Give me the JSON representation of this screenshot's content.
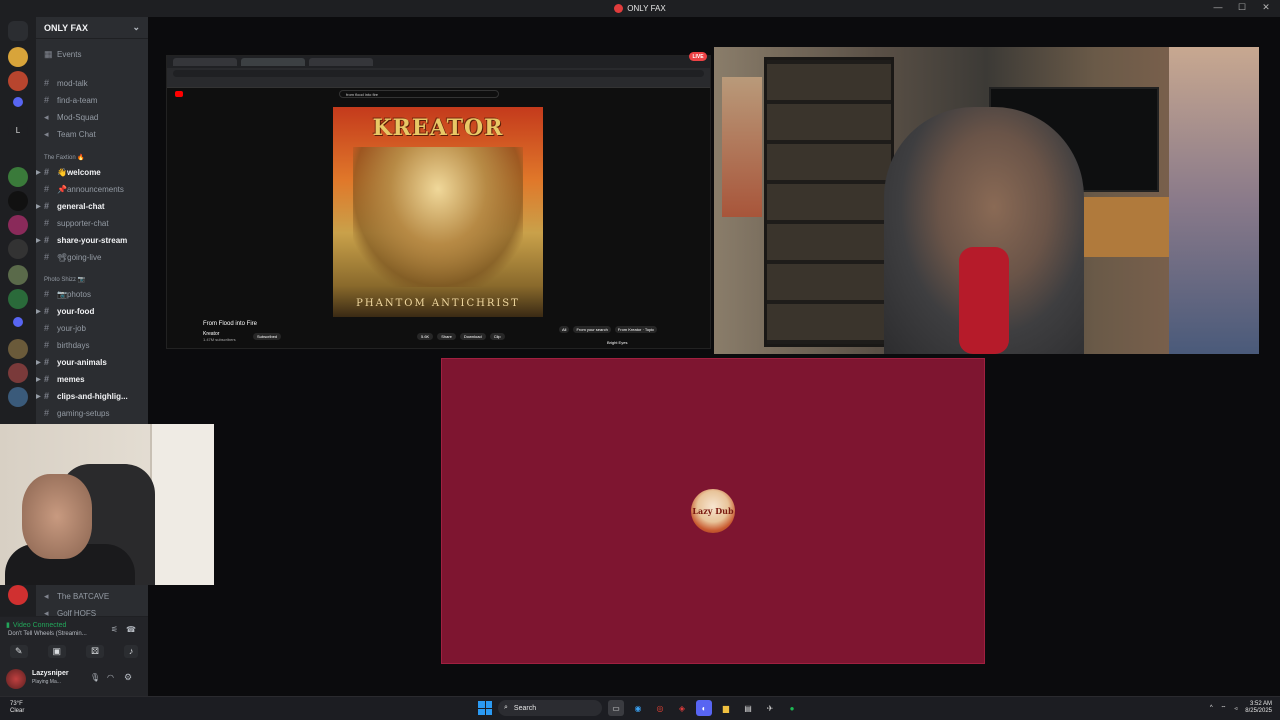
{
  "window": {
    "title": "ONLY FAX",
    "controls": [
      "—",
      "☐",
      "✕"
    ]
  },
  "server": {
    "name": "ONLY FAX",
    "events": "Events"
  },
  "channels": [
    {
      "name": "mod-talk",
      "type": "text",
      "unread": false
    },
    {
      "name": "find-a-team",
      "type": "text",
      "unread": false
    },
    {
      "name": "Mod-Squad",
      "type": "voice",
      "unread": false
    },
    {
      "name": "Team Chat",
      "type": "voice",
      "unread": false
    }
  ],
  "category_faction": "The Faxtion 🔥",
  "faction_channels": [
    {
      "name": "👋welcome",
      "unread": true
    },
    {
      "name": "📌announcements",
      "unread": false
    },
    {
      "name": "general-chat",
      "unread": true
    },
    {
      "name": "supporter-chat",
      "unread": false
    },
    {
      "name": "share-your-stream",
      "unread": true
    },
    {
      "name": "📽going-live",
      "unread": false
    }
  ],
  "category_photos": "Photo Shizz 📷",
  "photo_channels": [
    {
      "name": "📷photos",
      "unread": false
    },
    {
      "name": "your-food",
      "unread": true
    },
    {
      "name": "your-job",
      "unread": false
    },
    {
      "name": "birthdays",
      "unread": false
    },
    {
      "name": "your-animals",
      "unread": true
    },
    {
      "name": "memes",
      "unread": true
    },
    {
      "name": "clips-and-highlig...",
      "unread": true
    },
    {
      "name": "gaming-setups",
      "unread": false
    }
  ],
  "voice_channels": [
    {
      "name": "The BATCAVE"
    },
    {
      "name": "Golf HOFS"
    }
  ],
  "voice_status": {
    "connected": "Video Connected",
    "channel": "Don't Tell Wheels (Streamin..."
  },
  "user": {
    "name": "Lazysniper",
    "status": "Playing Ma..."
  },
  "stream": {
    "live_label": "LIVE",
    "yt_search": "from flood into fire",
    "video_title": "From Flood into Fire",
    "channel": "Kreator",
    "subscribers": "1.47M subscribers",
    "actions": [
      "Subscribed",
      "5.6K",
      "Share",
      "Download",
      "Clip"
    ],
    "side_chips": [
      "All",
      "From your search",
      "From Kreator · Topic"
    ],
    "up_next": "Bright Eyes",
    "album_band": "KREATOR",
    "album_title": "PHANTOM ANTICHRIST"
  },
  "avatar_tile": {
    "text": "Lazy Dub"
  },
  "taskbar": {
    "weather_temp": "73°F",
    "weather_desc": "Clear",
    "search_label": "Search",
    "time": "3:52 AM",
    "date": "8/25/2025"
  },
  "colors": {
    "discord_bg": "#2b2d31",
    "avatar_tile": "#7e1530",
    "live": "#ed4245",
    "accent": "#e03c3c"
  }
}
